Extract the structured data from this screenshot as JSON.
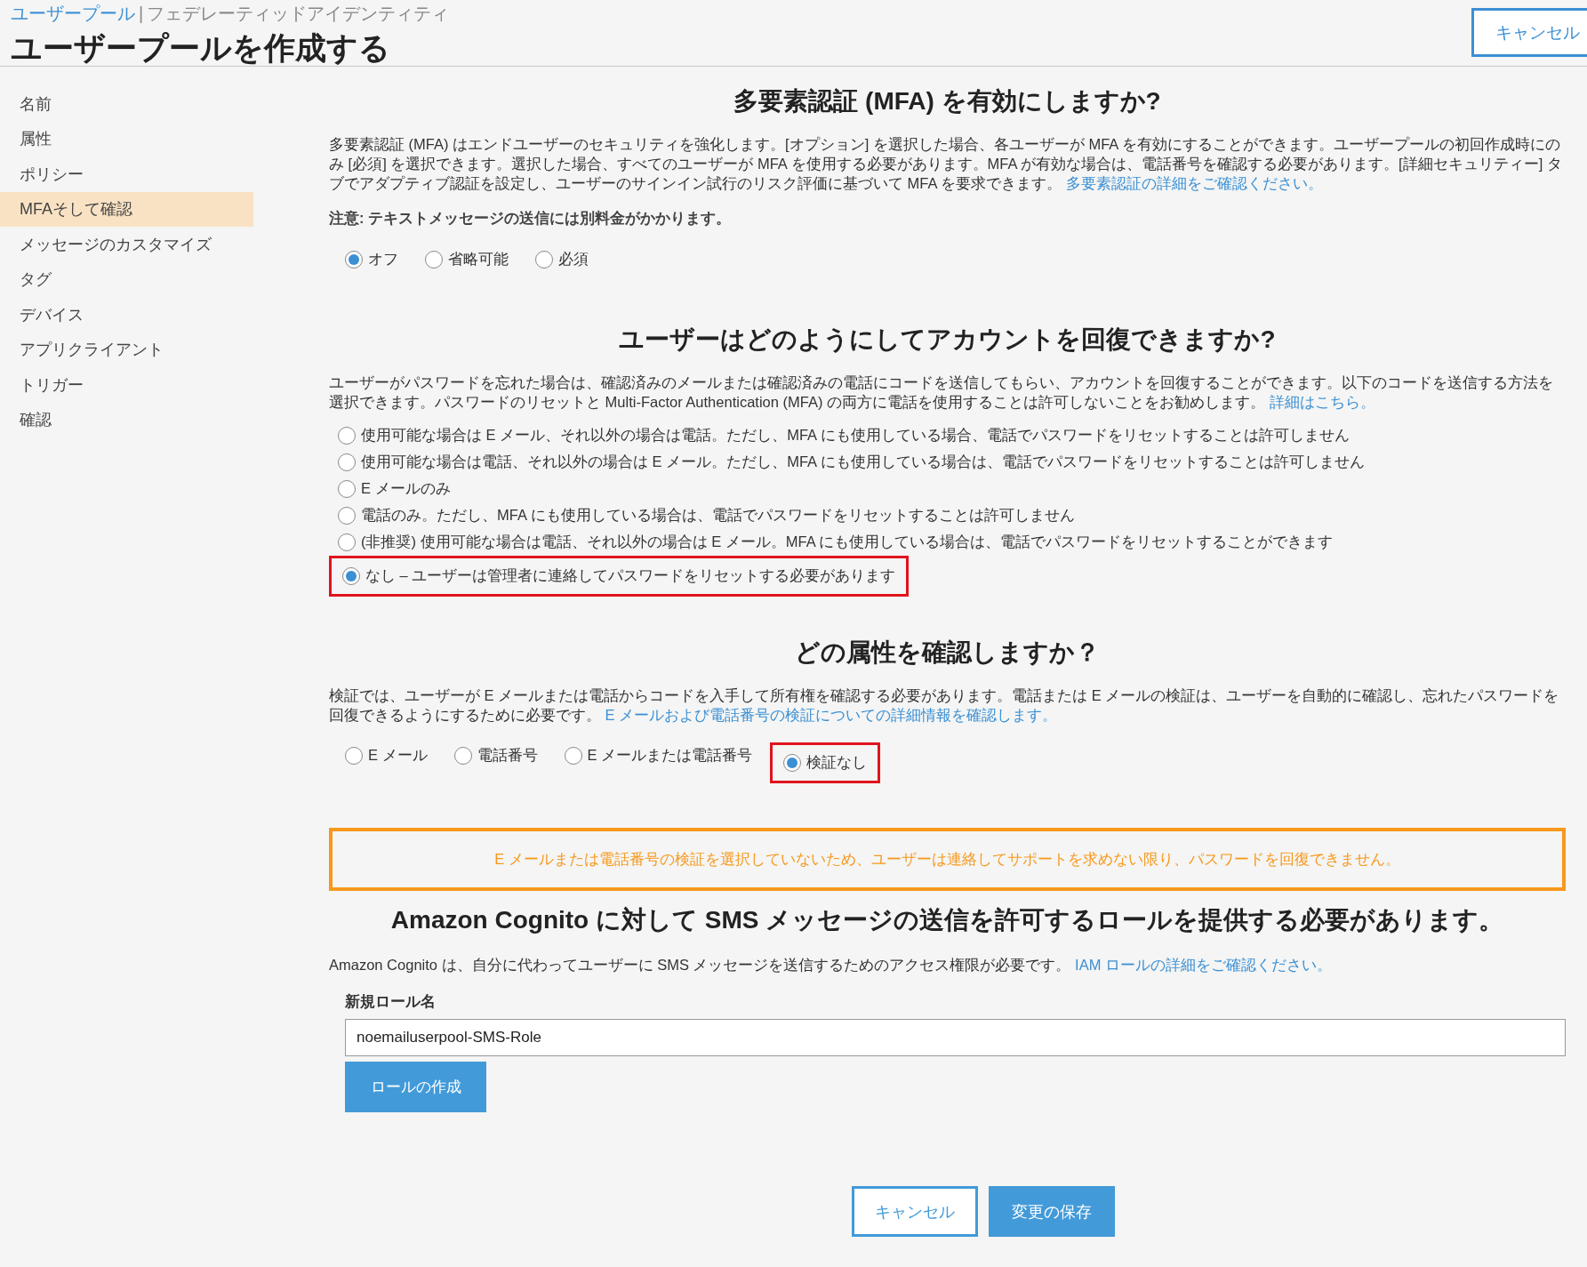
{
  "header": {
    "breadcrumb": [
      {
        "label": "ユーザープール",
        "selected": true
      },
      {
        "label": "フェデレーティッドアイデンティティ",
        "selected": false
      }
    ],
    "separator": "|",
    "title": "ユーザープールを作成する",
    "cancel": "キャンセル"
  },
  "sidebar": {
    "items": [
      {
        "label": "名前",
        "selected": false
      },
      {
        "label": "属性",
        "selected": false
      },
      {
        "label": "ポリシー",
        "selected": false
      },
      {
        "label": "MFAそして確認",
        "selected": true
      },
      {
        "label": "メッセージのカスタマイズ",
        "selected": false
      },
      {
        "label": "タグ",
        "selected": false
      },
      {
        "label": "デバイス",
        "selected": false
      },
      {
        "label": "アプリクライアント",
        "selected": false
      },
      {
        "label": "トリガー",
        "selected": false
      },
      {
        "label": "確認",
        "selected": false
      }
    ]
  },
  "mfa": {
    "heading": "多要素認証 (MFA) を有効にしますか?",
    "description": "多要素認証 (MFA) はエンドユーザーのセキュリティを強化します。[オプション] を選択した場合、各ユーザーが MFA を有効にすることができます。ユーザープールの初回作成時にのみ [必須] を選択できます。選択した場合、すべてのユーザーが MFA を使用する必要があります。MFA が有効な場合は、電話番号を確認する必要があります。[詳細セキュリティー] タブでアダプティブ認証を設定し、ユーザーのサインイン試行のリスク評価に基づいて MFA を要求できます。",
    "link": "多要素認証の詳細をご確認ください。",
    "note": "注意: テキストメッセージの送信には別料金がかかります。",
    "options": [
      {
        "label": "オフ",
        "selected": true,
        "highlighted": false
      },
      {
        "label": "省略可能",
        "selected": false,
        "highlighted": false
      },
      {
        "label": "必須",
        "selected": false,
        "highlighted": false
      }
    ]
  },
  "recovery": {
    "heading": "ユーザーはどのようにしてアカウントを回復できますか?",
    "description": "ユーザーがパスワードを忘れた場合は、確認済みのメールまたは確認済みの電話にコードを送信してもらい、アカウントを回復することができます。以下のコードを送信する方法を選択できます。パスワードのリセットと Multi-Factor Authentication (MFA) の両方に電話を使用することは許可しないことをお勧めします。",
    "link": "詳細はこちら。",
    "options": [
      {
        "label": "使用可能な場合は E メール、それ以外の場合は電話。ただし、MFA にも使用している場合、電話でパスワードをリセットすることは許可しません",
        "selected": false,
        "highlighted": false
      },
      {
        "label": "使用可能な場合は電話、それ以外の場合は E メール。ただし、MFA にも使用している場合は、電話でパスワードをリセットすることは許可しません",
        "selected": false,
        "highlighted": false
      },
      {
        "label": "E メールのみ",
        "selected": false,
        "highlighted": false
      },
      {
        "label": "電話のみ。ただし、MFA にも使用している場合は、電話でパスワードをリセットすることは許可しません",
        "selected": false,
        "highlighted": false
      },
      {
        "label": "(非推奨) 使用可能な場合は電話、それ以外の場合は E メール。MFA にも使用している場合は、電話でパスワードをリセットすることができます",
        "selected": false,
        "highlighted": false
      },
      {
        "label": "なし – ユーザーは管理者に連絡してパスワードをリセットする必要があります",
        "selected": true,
        "highlighted": true
      }
    ]
  },
  "verify": {
    "heading": "どの属性を確認しますか？",
    "description": "検証では、ユーザーが E メールまたは電話からコードを入手して所有権を確認する必要があります。電話または E メールの検証は、ユーザーを自動的に確認し、忘れたパスワードを回復できるようにするために必要です。",
    "link": "E メールおよび電話番号の検証についての詳細情報を確認します。",
    "options": [
      {
        "label": "E メール",
        "selected": false,
        "highlighted": false
      },
      {
        "label": "電話番号",
        "selected": false,
        "highlighted": false
      },
      {
        "label": "E メールまたは電話番号",
        "selected": false,
        "highlighted": false
      },
      {
        "label": "検証なし",
        "selected": true,
        "highlighted": true
      }
    ]
  },
  "warning": "E メールまたは電話番号の検証を選択していないため、ユーザーは連絡してサポートを求めない限り、パスワードを回復できません。",
  "sms": {
    "heading": "Amazon Cognito に対して SMS メッセージの送信を許可するロールを提供する必要があります。",
    "description": "Amazon Cognito は、自分に代わってユーザーに SMS メッセージを送信するためのアクセス権限が必要です。",
    "link": "IAM ロールの詳細をご確認ください。",
    "field_label": "新規ロール名",
    "field_value": "noemailuserpool-SMS-Role",
    "button": "ロールの作成"
  },
  "footer": {
    "cancel": "キャンセル",
    "save": "変更の保存"
  }
}
